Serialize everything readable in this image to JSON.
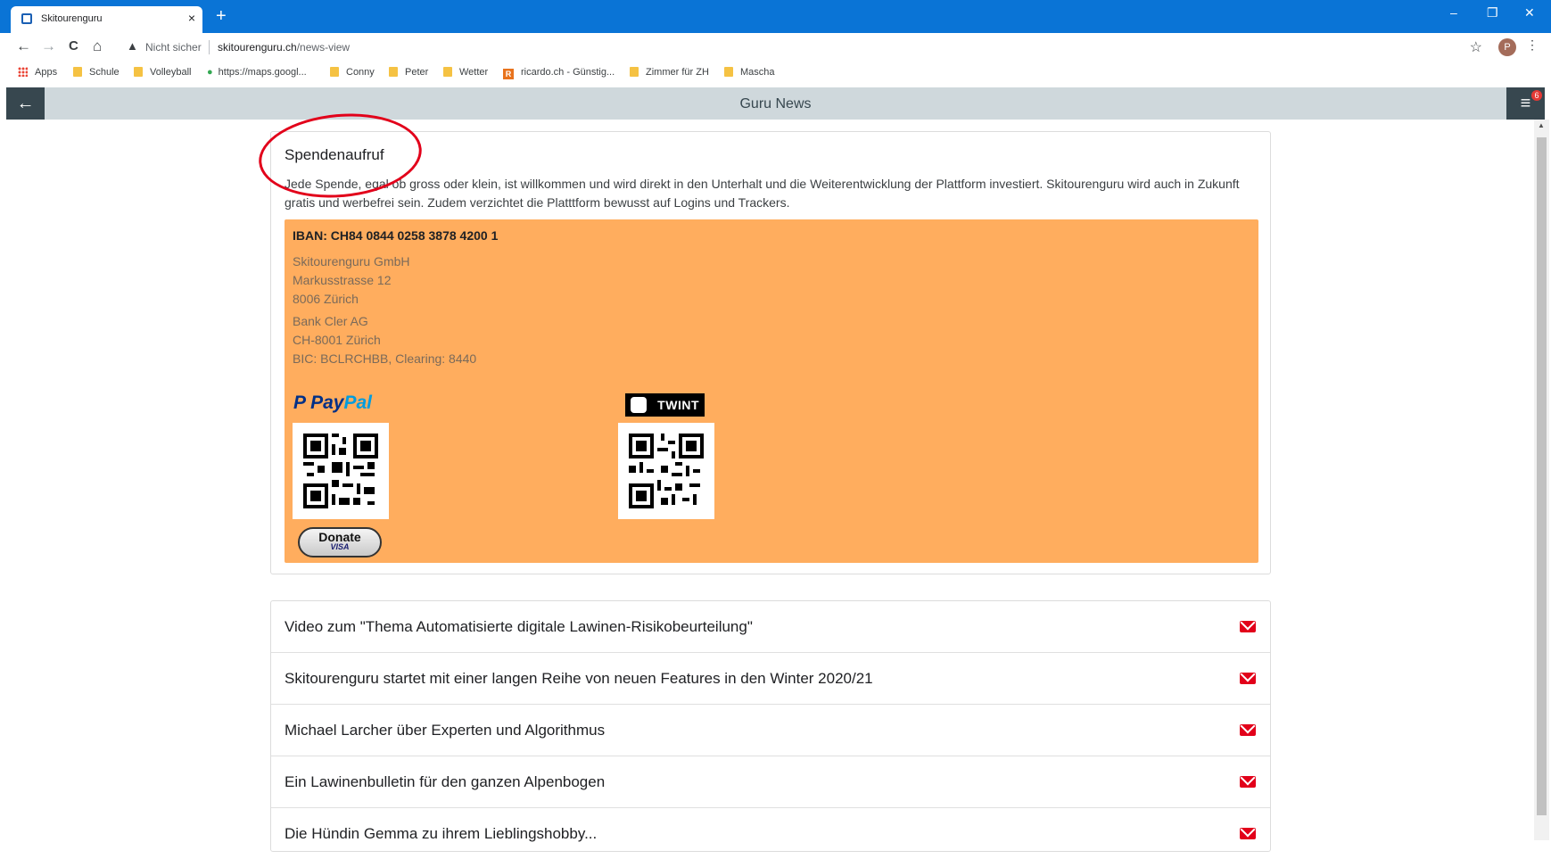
{
  "browser": {
    "tab_title": "Skitourenguru",
    "tab_close": "×",
    "new_tab": "+",
    "win_minimize": "–",
    "win_restore": "❐",
    "win_close": "✕",
    "nav_back": "←",
    "nav_forward": "→",
    "nav_reload": "C",
    "nav_home": "⌂",
    "security_label": "Nicht sicher",
    "url_host": "skitourenguru.ch",
    "url_path": "/news-view",
    "star": "☆",
    "profile_initial": "P",
    "menu": "⋮"
  },
  "bookmarks": [
    "Apps",
    "Schule",
    "Volleyball",
    "https://maps.googl...",
    "Conny",
    "Peter",
    "Wetter",
    "ricardo.ch - Günstig...",
    "Zimmer für ZH",
    "Mascha"
  ],
  "app": {
    "back": "←",
    "title": "Guru News",
    "menu": "≡",
    "badge": "6"
  },
  "donation": {
    "title": "Spendenaufruf",
    "text": "Jede Spende, egal ob gross oder klein, ist willkommen und wird direkt in den Unterhalt und die Weiterentwicklung der Plattform investiert. Skitourenguru wird auch in Zukunft gratis und werbefrei sein. Zudem verzichtet die Platttform bewusst auf Logins und Trackers.",
    "iban": "IBAN: CH84 0844 0258 3878 4200 1",
    "address": [
      "Skitourenguru GmbH",
      "Markusstrasse 12",
      "8006 Zürich"
    ],
    "bank": [
      "Bank Cler AG",
      "CH-8001 Zürich",
      "BIC: BCLRCHBB, Clearing: 8440"
    ],
    "paypal_pay": "Pay",
    "paypal_pal": "Pal",
    "twint": "TWINT",
    "donate_label": "Donate",
    "donate_cards": "VISA"
  },
  "news": [
    "Video zum \"Thema Automatisierte digitale Lawinen-Risikobeurteilung\"",
    "Skitourenguru startet mit einer langen Reihe von neuen Features in den Winter 2020/21",
    "Michael Larcher über Experten und Algorithmus",
    "Ein Lawinenbulletin für den ganzen Alpenbogen",
    "Die Hündin Gemma zu ihrem Lieblingshobby..."
  ],
  "colors": {
    "chrome_blue": "#0a74d6",
    "header_gray": "#cfd8dc",
    "header_dark": "#37474f",
    "donation_orange": "#ffad5e",
    "annotation_red": "#e2001a",
    "mail_red": "#e2001a"
  }
}
